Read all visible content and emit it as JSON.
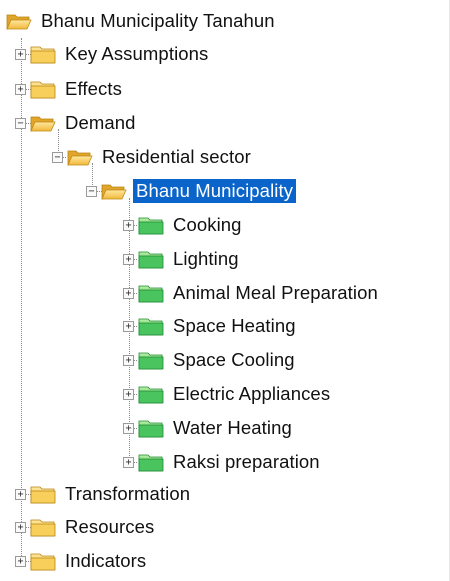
{
  "tree": {
    "root": {
      "label": "Bhanu Municipality Tanahun",
      "icon": "folder-open-icon"
    },
    "key_assumptions": {
      "label": "Key Assumptions",
      "toggle": "+"
    },
    "effects": {
      "label": "Effects",
      "toggle": "+"
    },
    "demand": {
      "label": "Demand",
      "toggle": "−"
    },
    "residential_sector": {
      "label": "Residential sector",
      "toggle": "−"
    },
    "bhanu_municipality": {
      "label": "Bhanu  Municipality",
      "toggle": "−",
      "selected": true
    },
    "children": [
      {
        "label": "Cooking",
        "toggle": "+"
      },
      {
        "label": "Lighting",
        "toggle": "+"
      },
      {
        "label": "Animal Meal Preparation",
        "toggle": "+"
      },
      {
        "label": "Space  Heating",
        "toggle": "+"
      },
      {
        "label": "Space Cooling",
        "toggle": "+"
      },
      {
        "label": "Electric Appliances",
        "toggle": "+"
      },
      {
        "label": "Water Heating",
        "toggle": "+"
      },
      {
        "label": "Raksi preparation",
        "toggle": "+"
      }
    ],
    "transformation": {
      "label": "Transformation",
      "toggle": "+"
    },
    "resources": {
      "label": "Resources",
      "toggle": "+"
    },
    "indicators": {
      "label": "Indicators",
      "toggle": "+"
    }
  },
  "colors": {
    "yellow_folder": "#f3c64a",
    "green_folder": "#34b04a",
    "selection": "#0a64c9"
  }
}
